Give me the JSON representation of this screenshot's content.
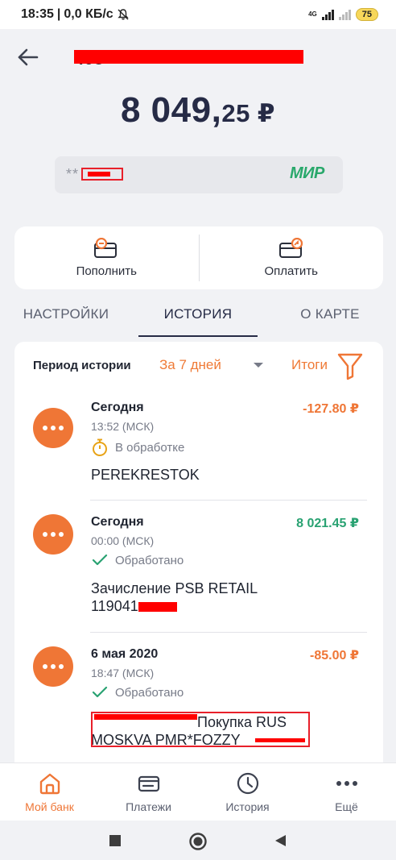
{
  "status_bar": {
    "time": "18:35",
    "separator": "|",
    "speed": "0,0 КБ/с",
    "network": "4G",
    "battery": "75"
  },
  "header": {
    "account_number_prefix": "408",
    "balance_main": "8 049,",
    "balance_fraction": "25 ₽",
    "card_mask": "**",
    "card_system": "МИР"
  },
  "actions": {
    "top_up_label": "Пополнить",
    "pay_label": "Оплатить"
  },
  "tabs": [
    {
      "label": "НАСТРОЙКИ",
      "active": false
    },
    {
      "label": "ИСТОРИЯ",
      "active": true
    },
    {
      "label": "О КАРТЕ",
      "active": false
    }
  ],
  "history": {
    "period_label": "Период истории",
    "period_value": "За 7 дней",
    "totals_label": "Итоги",
    "transactions": [
      {
        "date": "Сегодня",
        "time": "13:52 (МСК)",
        "status": "В обработке",
        "status_icon": "stopwatch-icon",
        "amount": "-127.80 ₽",
        "name": "PEREKRESTOK"
      },
      {
        "date": "Сегодня",
        "time": "00:00 (МСК)",
        "status": "Обработано",
        "status_icon": "check-icon",
        "amount": "8 021.45 ₽",
        "name_line1": "Зачисление PSB RETAIL",
        "name_line2": "119041"
      },
      {
        "date": "6 мая 2020",
        "time": "18:47 (МСК)",
        "status": "Обработано",
        "status_icon": "check-icon",
        "amount": "-85.00 ₽",
        "name_line1": "Покупка RUS",
        "name_line2": "MOSKVA PMR*FOZZY"
      }
    ]
  },
  "bottom_nav": [
    {
      "label": "Мой банк",
      "icon": "home-icon",
      "active": true
    },
    {
      "label": "Платежи",
      "icon": "wallet-icon",
      "active": false
    },
    {
      "label": "История",
      "icon": "clock-icon",
      "active": false
    },
    {
      "label": "Ещё",
      "icon": "more-icon",
      "active": false
    }
  ],
  "colors": {
    "accent": "#ef7636",
    "income": "#29a272",
    "dark_text": "#262b46",
    "redaction": "#ff0000"
  }
}
